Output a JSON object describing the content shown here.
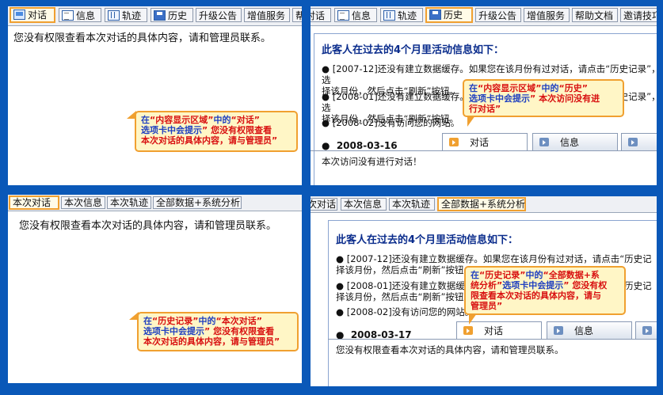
{
  "panel1": {
    "tabs": [
      "对话",
      "信息",
      "轨迹",
      "历史",
      "升级公告",
      "增值服务",
      "帮助"
    ],
    "message": "您没有权限查看本次对话的具体内容，请和管理员联系。",
    "callout": {
      "line1a": "在",
      "line1q": "“内容显示区域”",
      "line1b": "中的",
      "line1q2": "“对话”",
      "line2a": "选项卡中会提示",
      "line2q": "”",
      "line2red": "您没有权限查看",
      "line3red": "本次对话的具体内容，请与管理员”"
    }
  },
  "panel2": {
    "tabs": [
      "对话",
      "信息",
      "轨迹",
      "历史",
      "升级公告",
      "增值服务",
      "帮助文档",
      "邀请技巧"
    ],
    "heading": "此客人在过去的4个月里活动信息如下：",
    "items": [
      {
        "line1": "[2007-12]还没有建立数据缓存。如果您在该月份有过对话，请点击“历史记录”，选",
        "line2": "择该月份，然后点击“刷新”按钮。"
      },
      {
        "line1": "[2008-01]还没有建立数据缓存。如果您在该月份有过对话，请点击“历史记录”，选",
        "line2": "择该月份，然后点击“刷新”按钮。"
      },
      {
        "line1": "[2008-02]没有访问您的网站。"
      }
    ],
    "date": "2008-03-16",
    "ftabs": [
      "对话",
      "信息",
      ""
    ],
    "note": "本次访问没有进行对话！",
    "callout": {
      "l1a": "在",
      "l1q": "“内容显示区域”",
      "l1b": "中的",
      "l1q2": "“历史”",
      "l2a": "选项卡中会提示",
      "l2q": "”",
      "l2red": "本次访问没有进",
      "l3red": "行对话”"
    }
  },
  "panel3": {
    "tabs": [
      "本次对话",
      "本次信息",
      "本次轨迹",
      "全部数据+系统分析"
    ],
    "message": "您没有权限查看本次对话的具体内容，请和管理员联系。",
    "callout": {
      "l1a": "在",
      "l1q": "“历史记录”",
      "l1b": "中的",
      "l1q2": "“本次对话”",
      "l2a": "选项卡中会提示",
      "l2q": "”",
      "l2red": "您没有权限查看",
      "l3red": "本次对话的具体内容，请与管理员”"
    }
  },
  "panel4": {
    "tabs": [
      "次对话",
      "本次信息",
      "本次轨迹",
      "全部数据+系统分析"
    ],
    "heading": "此客人在过去的4个月里活动信息如下：",
    "items": [
      {
        "line1": "[2007-12]还没有建立数据缓存。如果您在该月份有过对话，请点击“历史记",
        "line2": "择该月份，然后点击“刷新”按钮。"
      },
      {
        "line1": "[2008-01]还没有建立数据缓存。如果您在该月份有过对话，请点击“历史记",
        "line2": "择该月份，然后点击“刷新”按钮。"
      },
      {
        "line1": "[2008-02]没有访问您的网站。"
      }
    ],
    "date": "2008-03-17",
    "ftabs": [
      "对话",
      "信息",
      ""
    ],
    "note": "您没有权限查看本次对话的具体内容，请和管理员联系。",
    "callout": {
      "l1a": "在",
      "l1q": "“历史记录”",
      "l1b": "中的",
      "l1q2": "“全部数据+系",
      "l2q": "统分析”",
      "l2a": "选项卡中会提示",
      "l2q2": "”",
      "l2red": "您没有权",
      "l3red": "限查看本次对话的具体内容，请与",
      "l4red": "管理员”"
    }
  },
  "colors": {
    "background": "#0a58b8",
    "callout_border": "#f0a030",
    "callout_fill": "#fff6c6",
    "heading": "#0a2c8c",
    "highlight_red": "#d81010",
    "callout_blue": "#1e3fc0"
  }
}
